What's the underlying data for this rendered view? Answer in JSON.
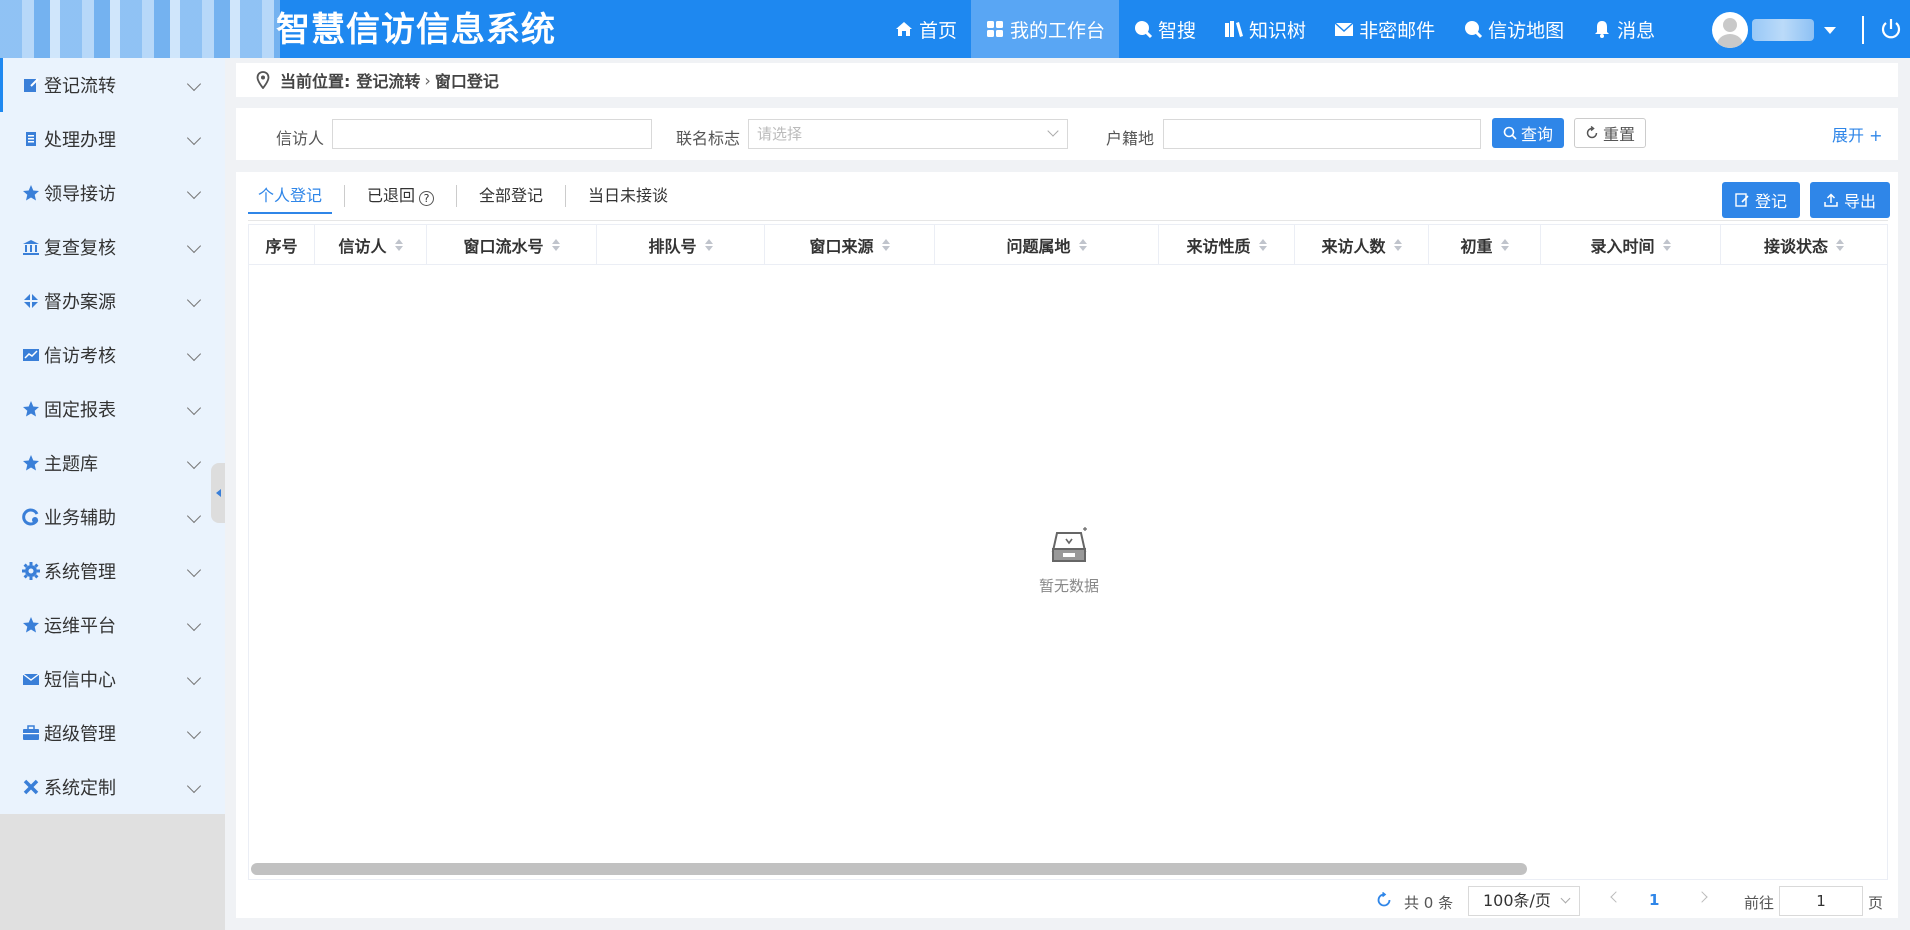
{
  "header": {
    "title": "智慧信访信息系统",
    "nav": [
      {
        "label": "首页",
        "icon": "home-icon",
        "active": false
      },
      {
        "label": "我的工作台",
        "icon": "dashboard-icon",
        "active": true
      },
      {
        "label": "智搜",
        "icon": "search-icon",
        "active": false
      },
      {
        "label": "知识树",
        "icon": "books-icon",
        "active": false
      },
      {
        "label": "非密邮件",
        "icon": "mail-icon",
        "active": false
      },
      {
        "label": "信访地图",
        "icon": "map-icon",
        "active": false
      },
      {
        "label": "消息",
        "icon": "bell-icon",
        "active": false
      }
    ]
  },
  "sidebar": {
    "items": [
      {
        "label": "登记流转",
        "icon": "register-icon"
      },
      {
        "label": "处理办理",
        "icon": "document-icon"
      },
      {
        "label": "领导接访",
        "icon": "star-icon"
      },
      {
        "label": "复查复核",
        "icon": "bank-icon"
      },
      {
        "label": "督办案源",
        "icon": "supervise-icon"
      },
      {
        "label": "信访考核",
        "icon": "chart-icon"
      },
      {
        "label": "固定报表",
        "icon": "star-icon"
      },
      {
        "label": "主题库",
        "icon": "star-icon"
      },
      {
        "label": "业务辅助",
        "icon": "assist-icon"
      },
      {
        "label": "系统管理",
        "icon": "gear-icon"
      },
      {
        "label": "运维平台",
        "icon": "star-icon"
      },
      {
        "label": "短信中心",
        "icon": "mail-icon"
      },
      {
        "label": "超级管理",
        "icon": "briefcase-icon"
      },
      {
        "label": "系统定制",
        "icon": "tools-icon"
      }
    ]
  },
  "breadcrumb": {
    "prefix": "当前位置:",
    "parent": "登记流转",
    "current": "窗口登记"
  },
  "filter": {
    "petitioner_label": "信访人",
    "petitioner_value": "",
    "joint_label": "联名标志",
    "joint_placeholder": "请选择",
    "domicile_label": "户籍地",
    "domicile_value": "",
    "query_label": "查询",
    "reset_label": "重置",
    "expand_label": "展开 +"
  },
  "tabs": [
    {
      "label": "个人登记",
      "active": true
    },
    {
      "label": "已退回",
      "active": false,
      "help": "?"
    },
    {
      "label": "全部登记",
      "active": false
    },
    {
      "label": "当日未接谈",
      "active": false
    }
  ],
  "actions": {
    "register_label": "登记",
    "export_label": "导出"
  },
  "table": {
    "columns": [
      "序号",
      "信访人",
      "窗口流水号",
      "排队号",
      "窗口来源",
      "问题属地",
      "来访性质",
      "来访人数",
      "初重",
      "录入时间",
      "接谈状态"
    ],
    "rows": [],
    "empty_text": "暂无数据"
  },
  "pagination": {
    "total_text": "共 0 条",
    "page_size": "100条/页",
    "current_page": "1",
    "goto_label": "前往",
    "goto_value": "1",
    "page_suffix": "页"
  },
  "colors": {
    "primary": "#1e88f0",
    "accent": "#2f86e8"
  }
}
